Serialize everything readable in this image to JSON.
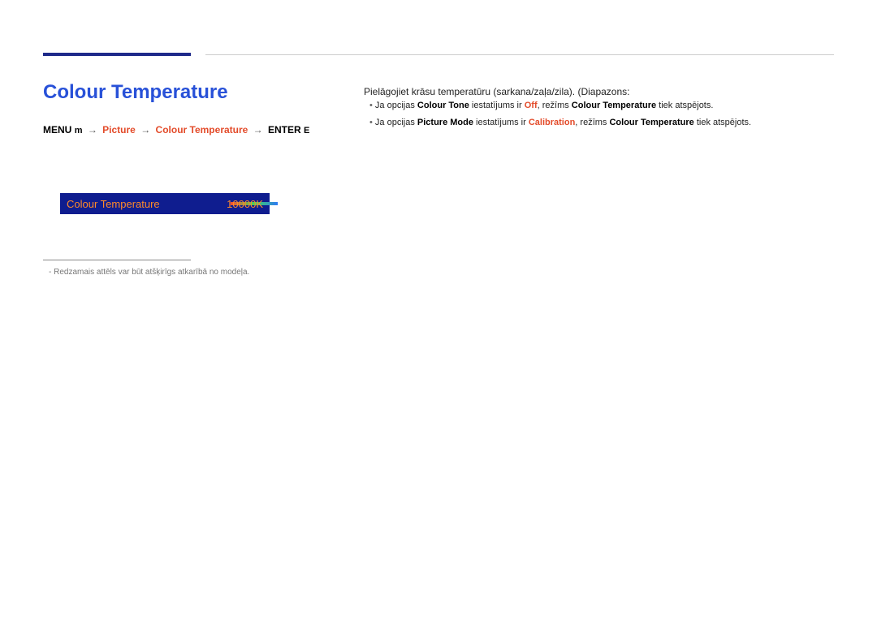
{
  "title": "Colour Temperature",
  "breadcrumb": {
    "menu": "MENU",
    "btn": "m",
    "step1": "Picture",
    "step2": "Colour Temperature",
    "enter": "ENTER",
    "enter_icon": "E"
  },
  "slider": {
    "label": "Colour Temperature",
    "value": "10000K"
  },
  "footnote": "Redzamais attēls var būt atšķirīgs atkarībā no modeļa.",
  "right": {
    "desc": "Pielāgojiet krāsu temperatūru (sarkana/zaļa/zila). (Diapazons:",
    "b1_before": "Ja opcijas ",
    "b1_k1": "Colour Tone",
    "b1_mid": " iestatījums ir ",
    "b1_r1": "Off",
    "b1_mid2": ", režīms ",
    "b1_k2": "Colour Temperature",
    "b1_after": " tiek atspējots.",
    "b2_before": "Ja opcijas ",
    "b2_k1": "Picture Mode",
    "b2_mid": " iestatījums ir ",
    "b2_r1": "Calibration",
    "b2_mid2": ", režīms ",
    "b2_k2": "Colour Temperature",
    "b2_after": " tiek atspējots."
  }
}
